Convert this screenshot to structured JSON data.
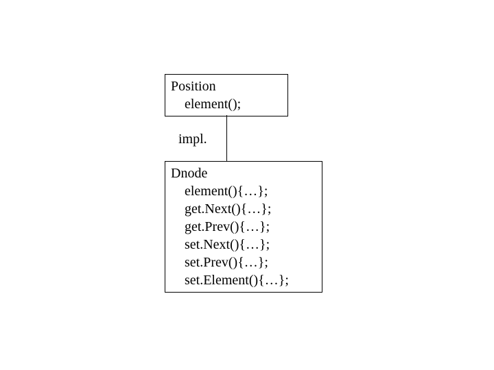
{
  "top_box": {
    "title": "Position",
    "methods": [
      "element();"
    ]
  },
  "connector_label": "impl.",
  "bottom_box": {
    "title": "Dnode",
    "methods": [
      "element(){…};",
      "get.Next(){…};",
      "get.Prev(){…};",
      "set.Next(){…};",
      "set.Prev(){…};",
      "set.Element(){…};"
    ]
  }
}
